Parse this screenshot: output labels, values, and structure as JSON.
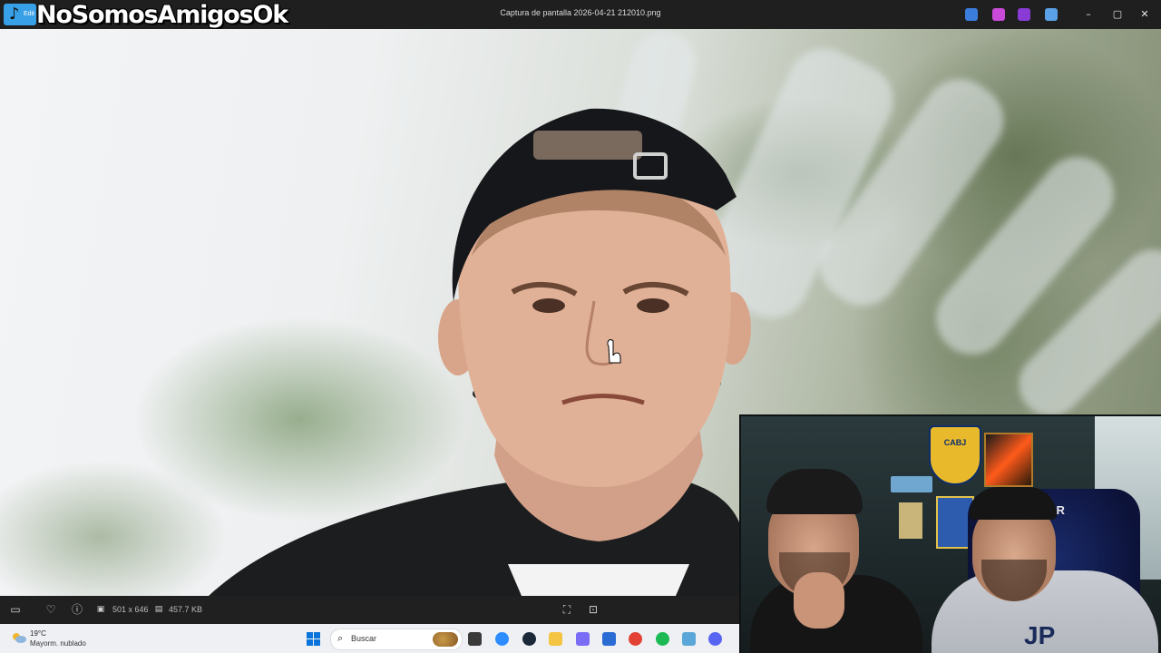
{
  "window": {
    "title": "Captura de pantalla 2026-04-21 212010.png",
    "watermark": "NoSomosAmigosOk",
    "app_tile_label": "Edit"
  },
  "titlebar_actions": [
    {
      "name": "app-icon-1",
      "color": "#3b7ddd"
    },
    {
      "name": "app-icon-2",
      "color": "#c94ad8"
    },
    {
      "name": "app-icon-3",
      "color": "#8a3bd6"
    },
    {
      "name": "app-icon-4",
      "color": "#5aa0e6"
    }
  ],
  "window_controls": {
    "minimize": "–",
    "maximize": "▢",
    "close": "✕"
  },
  "viewer_footer": {
    "dimensions": "501 x 646",
    "file_size": "457.7 KB"
  },
  "taskbar": {
    "weather_temp": "19°C",
    "weather_condition": "Mayorm. nublado",
    "search_placeholder": "Buscar",
    "apps": [
      {
        "name": "task-view",
        "color": "#3a3a3a"
      },
      {
        "name": "zoom",
        "color": "#2d8cff"
      },
      {
        "name": "steam",
        "color": "#1b2838"
      },
      {
        "name": "file-explorer",
        "color": "#f4c542"
      },
      {
        "name": "copilot",
        "color": "#7b6cf6"
      },
      {
        "name": "store",
        "color": "#2b6cd4"
      },
      {
        "name": "chrome",
        "color": "#e34133"
      },
      {
        "name": "spotify",
        "color": "#1db954"
      },
      {
        "name": "photos",
        "color": "#5aa6d8"
      },
      {
        "name": "discord",
        "color": "#5865f2"
      }
    ]
  },
  "webcam": {
    "shield_text": "CABJ",
    "chair_brand": "SDAR",
    "shirt_logo": "JP"
  }
}
